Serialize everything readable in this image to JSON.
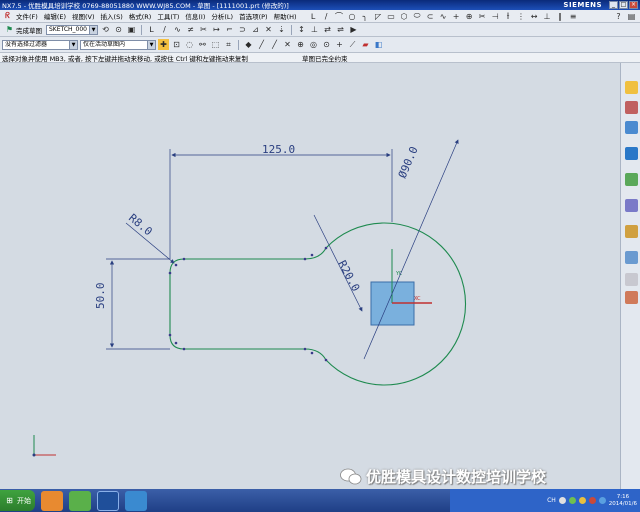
{
  "window": {
    "title": "NX7.5 - 优胜模具培训学校 0769-88051880 WWW.WJ85.COM - 草图 - [1111001.prt (修改的)]",
    "brand": "SIEMENS"
  },
  "menubar": {
    "items": [
      {
        "label": "文件(F)"
      },
      {
        "label": "编辑(E)"
      },
      {
        "label": "视图(V)"
      },
      {
        "label": "插入(S)"
      },
      {
        "label": "格式(R)"
      },
      {
        "label": "工具(T)"
      },
      {
        "label": "信息(I)"
      },
      {
        "label": "分析(L)"
      },
      {
        "label": "首选项(P)"
      },
      {
        "label": "帮助(H)"
      }
    ]
  },
  "toolbar1": {
    "finish_sketch": "完成草图",
    "sketch_name": "SKETCH_000"
  },
  "toolbar2": {
    "selection_filter": "没有选择过滤器",
    "selection_scope": "仅在活动草图内"
  },
  "status": {
    "cue": "选择对象并使用 MB3, 或者, 按下左键并拖动来移动, 或按住 Ctrl 键和左键拖动来复制",
    "message": "草图已完全约束"
  },
  "sketch": {
    "dimensions": {
      "length": "125.0",
      "height": "50.0",
      "corner_radius": "R8.0",
      "fillet_radius": "R20.0",
      "diameter": "Ø90.0"
    },
    "colors": {
      "curve": "#1e8a4f",
      "dimension": "#2a3f80",
      "point": "#3a3a8a",
      "datum_square": "#6aa8dc"
    }
  },
  "watermark": {
    "text": "优胜模具设计数控培训学校"
  },
  "taskbar": {
    "start_label": "开始",
    "tray_label": "CH",
    "clock_time": "7:16",
    "clock_date": "2014/01/6"
  }
}
